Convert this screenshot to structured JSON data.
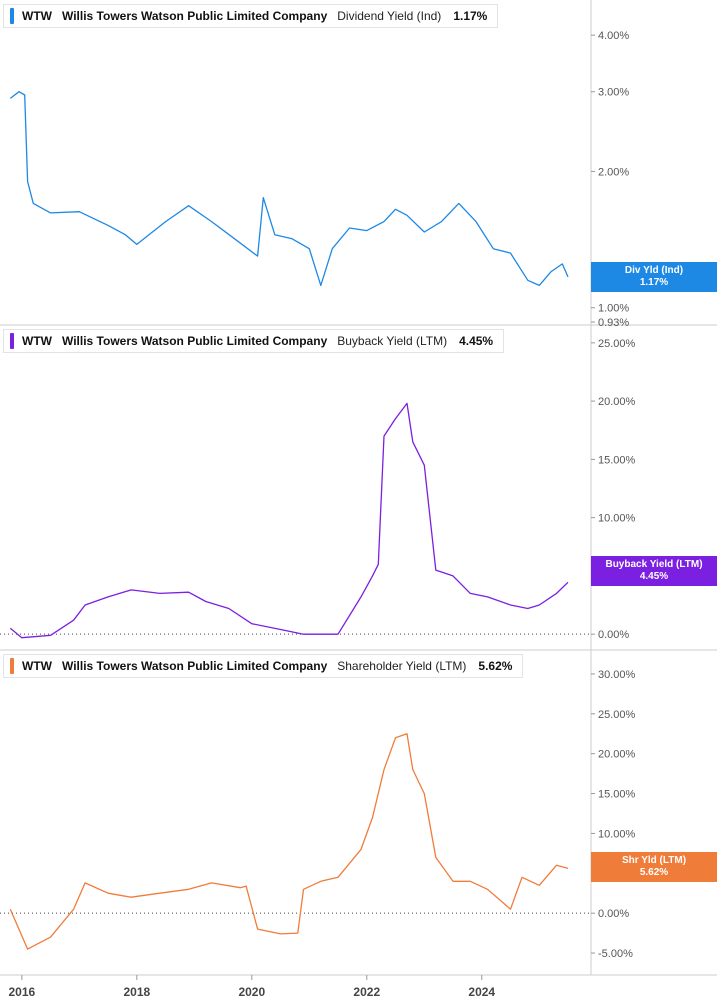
{
  "colors": {
    "panel1": "#1e88e5",
    "panel2": "#7b1fe0",
    "panel3": "#f07c3a",
    "text": "#333333",
    "grid": "#dddddd"
  },
  "panels": [
    {
      "ticker": "WTW",
      "company": "Willis Towers Watson Public Limited Company",
      "metric": "Dividend Yield (Ind)",
      "value": "1.17%",
      "badge_line1": "Div Yld (Ind)",
      "badge_line2": "1.17%"
    },
    {
      "ticker": "WTW",
      "company": "Willis Towers Watson Public Limited Company",
      "metric": "Buyback Yield (LTM)",
      "value": "4.45%",
      "badge_line1": "Buyback Yield (LTM)",
      "badge_line2": "4.45%"
    },
    {
      "ticker": "WTW",
      "company": "Willis Towers Watson Public Limited Company",
      "metric": "Shareholder Yield (LTM)",
      "value": "5.62%",
      "badge_line1": "Shr Yld (LTM)",
      "badge_line2": "5.62%"
    }
  ],
  "chart_data": [
    {
      "type": "line",
      "series": [
        {
          "name": "Dividend Yield (Ind)",
          "x": [
            2015.8,
            2015.95,
            2016.05,
            2016.1,
            2016.2,
            2016.5,
            2017.0,
            2017.5,
            2017.8,
            2018.0,
            2018.5,
            2018.9,
            2019.3,
            2019.7,
            2020.1,
            2020.2,
            2020.4,
            2020.7,
            2021.0,
            2021.2,
            2021.4,
            2021.7,
            2022.0,
            2022.3,
            2022.5,
            2022.7,
            2023.0,
            2023.3,
            2023.6,
            2023.9,
            2024.2,
            2024.5,
            2024.8,
            2025.0,
            2025.2,
            2025.4,
            2025.5
          ],
          "y": [
            2.9,
            3.0,
            2.95,
            1.9,
            1.7,
            1.62,
            1.63,
            1.52,
            1.45,
            1.38,
            1.55,
            1.68,
            1.55,
            1.42,
            1.3,
            1.75,
            1.45,
            1.42,
            1.35,
            1.12,
            1.35,
            1.5,
            1.48,
            1.55,
            1.65,
            1.6,
            1.47,
            1.55,
            1.7,
            1.55,
            1.35,
            1.32,
            1.15,
            1.12,
            1.2,
            1.25,
            1.17
          ]
        }
      ],
      "y_ticks": [
        "4.00%",
        "3.00%",
        "2.00%",
        "1.00%",
        "0.93%"
      ],
      "ylim": [
        0.93,
        4.5
      ],
      "scale": "log"
    },
    {
      "type": "line",
      "series": [
        {
          "name": "Buyback Yield (LTM)",
          "x": [
            2015.8,
            2016.0,
            2016.5,
            2016.9,
            2017.1,
            2017.5,
            2017.9,
            2018.4,
            2018.9,
            2019.2,
            2019.6,
            2020.0,
            2020.5,
            2020.9,
            2021.5,
            2021.9,
            2022.1,
            2022.2,
            2022.3,
            2022.5,
            2022.7,
            2022.8,
            2023.0,
            2023.2,
            2023.5,
            2023.8,
            2024.1,
            2024.5,
            2024.8,
            2025.0,
            2025.3,
            2025.5
          ],
          "y": [
            0.5,
            -0.3,
            -0.1,
            1.2,
            2.5,
            3.2,
            3.8,
            3.5,
            3.6,
            2.8,
            2.2,
            0.9,
            0.4,
            0.0,
            0.0,
            3.2,
            5.0,
            6.0,
            17.0,
            18.5,
            19.8,
            16.5,
            14.5,
            5.5,
            5.0,
            3.5,
            3.2,
            2.5,
            2.2,
            2.5,
            3.5,
            4.45
          ]
        }
      ],
      "y_ticks": [
        "25.00%",
        "20.00%",
        "15.00%",
        "10.00%",
        "5.00%",
        "0.00%"
      ],
      "ylim": [
        -0.5,
        25.5
      ]
    },
    {
      "type": "line",
      "series": [
        {
          "name": "Shareholder Yield (LTM)",
          "x": [
            2015.8,
            2016.1,
            2016.5,
            2016.9,
            2017.1,
            2017.5,
            2017.9,
            2018.4,
            2018.9,
            2019.3,
            2019.8,
            2019.9,
            2020.1,
            2020.5,
            2020.8,
            2020.9,
            2021.2,
            2021.5,
            2021.9,
            2022.1,
            2022.3,
            2022.5,
            2022.7,
            2022.8,
            2023.0,
            2023.2,
            2023.5,
            2023.8,
            2024.1,
            2024.5,
            2024.7,
            2025.0,
            2025.3,
            2025.5
          ],
          "y": [
            0.5,
            -4.5,
            -3.0,
            0.5,
            3.8,
            2.5,
            2.0,
            2.5,
            3.0,
            3.8,
            3.2,
            3.4,
            -2.0,
            -2.6,
            -2.5,
            3.0,
            4.0,
            4.5,
            8.0,
            12.0,
            18.0,
            22.0,
            22.5,
            18.0,
            15.0,
            7.0,
            4.0,
            4.0,
            3.0,
            0.5,
            4.5,
            3.5,
            6.0,
            5.62
          ]
        }
      ],
      "y_ticks": [
        "30.00%",
        "25.00%",
        "20.00%",
        "15.00%",
        "10.00%",
        "5.00%",
        "0.00%",
        "-5.00%"
      ],
      "ylim": [
        -6.5,
        31.5
      ]
    }
  ],
  "x_axis": {
    "ticks": [
      "2016",
      "2018",
      "2020",
      "2022",
      "2024"
    ],
    "tick_values": [
      2016,
      2018,
      2020,
      2022,
      2024
    ],
    "range": [
      2015.62,
      2025.9
    ]
  }
}
